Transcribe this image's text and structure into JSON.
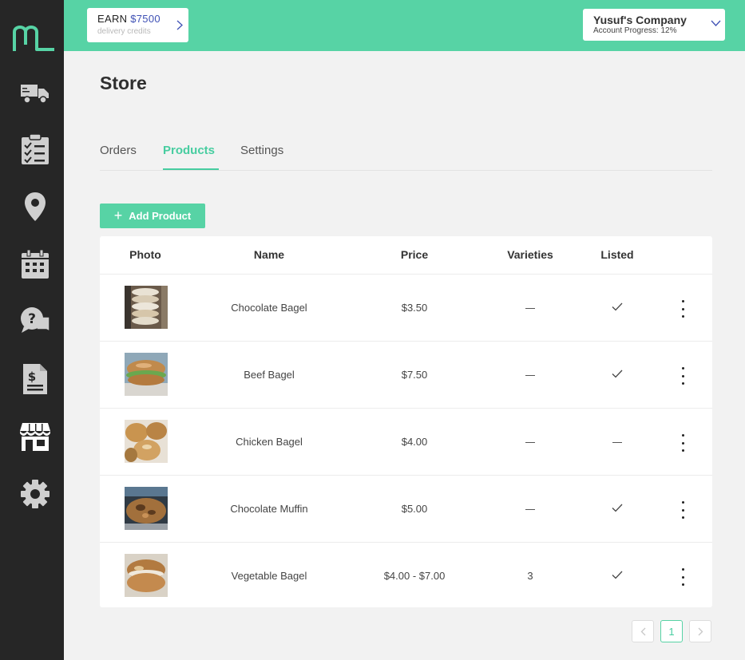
{
  "topbar": {
    "earn_label": "EARN",
    "earn_amount": "$7500",
    "earn_sub": "delivery credits",
    "company_name": "Yusuf's Company",
    "company_progress": "Account Progress: 12%"
  },
  "sidebar": {
    "items": [
      "truck-icon",
      "checklist-icon",
      "map-pin-icon",
      "calendar-icon",
      "help-chat-icon",
      "invoice-icon",
      "store-icon",
      "settings-icon"
    ]
  },
  "page": {
    "title": "Store",
    "tabs": [
      "Orders",
      "Products",
      "Settings"
    ],
    "active_tab": "Products",
    "add_button": "Add Product"
  },
  "table": {
    "headers": [
      "Photo",
      "Name",
      "Price",
      "Varieties",
      "Listed"
    ],
    "rows": [
      {
        "name": "Chocolate Bagel",
        "price": "$3.50",
        "varieties": "",
        "listed": true
      },
      {
        "name": "Beef Bagel",
        "price": "$7.50",
        "varieties": "",
        "listed": true
      },
      {
        "name": "Chicken Bagel",
        "price": "$4.00",
        "varieties": "",
        "listed": false
      },
      {
        "name": "Chocolate Muffin",
        "price": "$5.00",
        "varieties": "",
        "listed": true
      },
      {
        "name": "Vegetable Bagel",
        "price": "$4.00 - $7.00",
        "varieties": "3",
        "listed": true
      }
    ]
  },
  "pagination": {
    "current": "1"
  },
  "colors": {
    "accent": "#57d3a5",
    "sidebar": "#262626",
    "earn_amount": "#3f51b5"
  }
}
